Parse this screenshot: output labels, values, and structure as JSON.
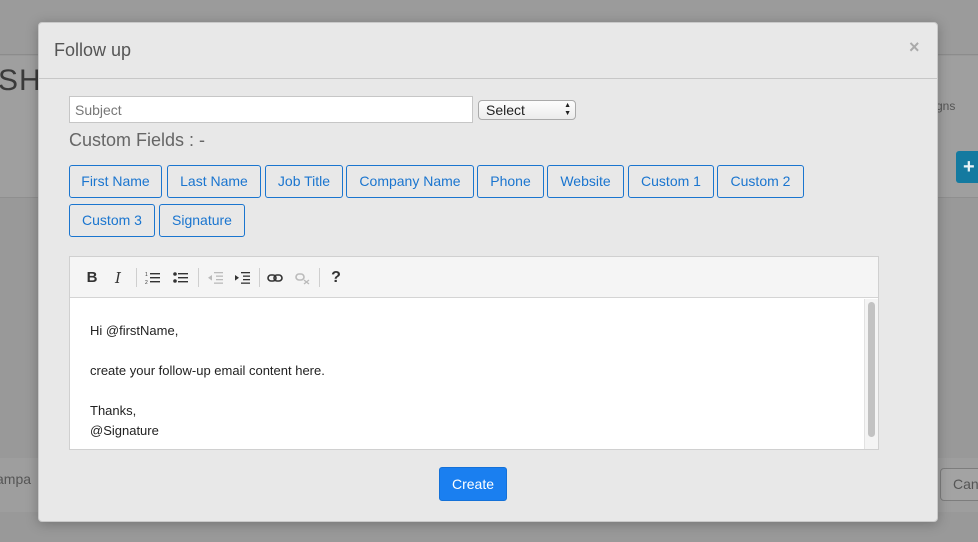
{
  "background": {
    "title_fragment": "SHE",
    "right_text_fragment": "gns",
    "plus_button": "+",
    "footer_text_fragment": "ampa",
    "cancel_fragment": "Can"
  },
  "modal": {
    "title": "Follow up",
    "close_symbol": "×",
    "subject_placeholder": "Subject",
    "subject_value": "",
    "select_value": "Select",
    "custom_fields_label": "Custom Fields : -",
    "field_buttons": [
      "First Name",
      "Last Name",
      "Job Title",
      "Company Name",
      "Phone",
      "Website",
      "Custom 1",
      "Custom 2",
      "Custom 3",
      "Signature"
    ],
    "toolbar": {
      "bold": "B",
      "italic": "I",
      "ordered_list_icon": "ordered-list-icon",
      "unordered_list_icon": "unordered-list-icon",
      "outdent_icon": "outdent-icon",
      "indent_icon": "indent-icon",
      "link_icon": "link-icon",
      "unlink_icon": "unlink-icon",
      "help": "?"
    },
    "editor_lines": [
      "Hi @firstName,",
      "",
      "create your follow-up email content here.",
      "",
      "Thanks,",
      "@Signature"
    ],
    "create_label": "Create"
  },
  "colors": {
    "accent": "#1a7ff0",
    "field_button_border": "#1a75cf"
  }
}
